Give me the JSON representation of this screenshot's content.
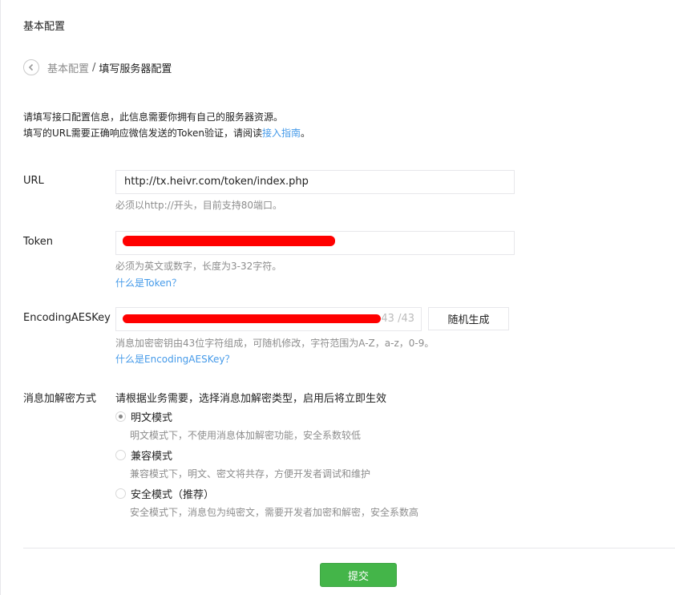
{
  "page": {
    "title": "基本配置",
    "breadcrumb": {
      "parent": "基本配置",
      "separator": "/",
      "current": "填写服务器配置"
    }
  },
  "intro": {
    "line1": "请填写接口配置信息，此信息需要你拥有自己的服务器资源。",
    "line2_before": "填写的URL需要正确响应微信发送的Token验证，请阅读",
    "line2_link": "接入指南",
    "line2_after": "。"
  },
  "fields": {
    "url": {
      "label": "URL",
      "value": "http://tx.heivr.com/token/index.php",
      "hint": "必须以http://开头，目前支持80端口。"
    },
    "token": {
      "label": "Token",
      "value": "",
      "hint": "必须为英文或数字，长度为3-32字符。",
      "help_link": "什么是Token？"
    },
    "aes_key": {
      "label": "EncodingAESKey",
      "value": "",
      "counter": "43 /43",
      "random_button": "随机生成",
      "hint": "消息加密密钥由43位字符组成，可随机修改，字符范围为A-Z，a-z，0-9。",
      "help_link": "什么是EncodingAESKey？"
    }
  },
  "encryption": {
    "label": "消息加解密方式",
    "description": "请根据业务需要，选择消息加解密类型，启用后将立即生效",
    "options": [
      {
        "label": "明文模式",
        "desc": "明文模式下，不使用消息体加解密功能，安全系数较低",
        "checked": true
      },
      {
        "label": "兼容模式",
        "desc": "兼容模式下，明文、密文将共存，方便开发者调试和维护",
        "checked": false
      },
      {
        "label": "安全模式（推荐）",
        "desc": "安全模式下，消息包为纯密文，需要开发者加密和解密，安全系数高",
        "checked": false
      }
    ]
  },
  "submit_label": "提交",
  "colors": {
    "accent_green": "#44b549",
    "link_blue": "#459ae9",
    "redaction": "#ff0000"
  }
}
